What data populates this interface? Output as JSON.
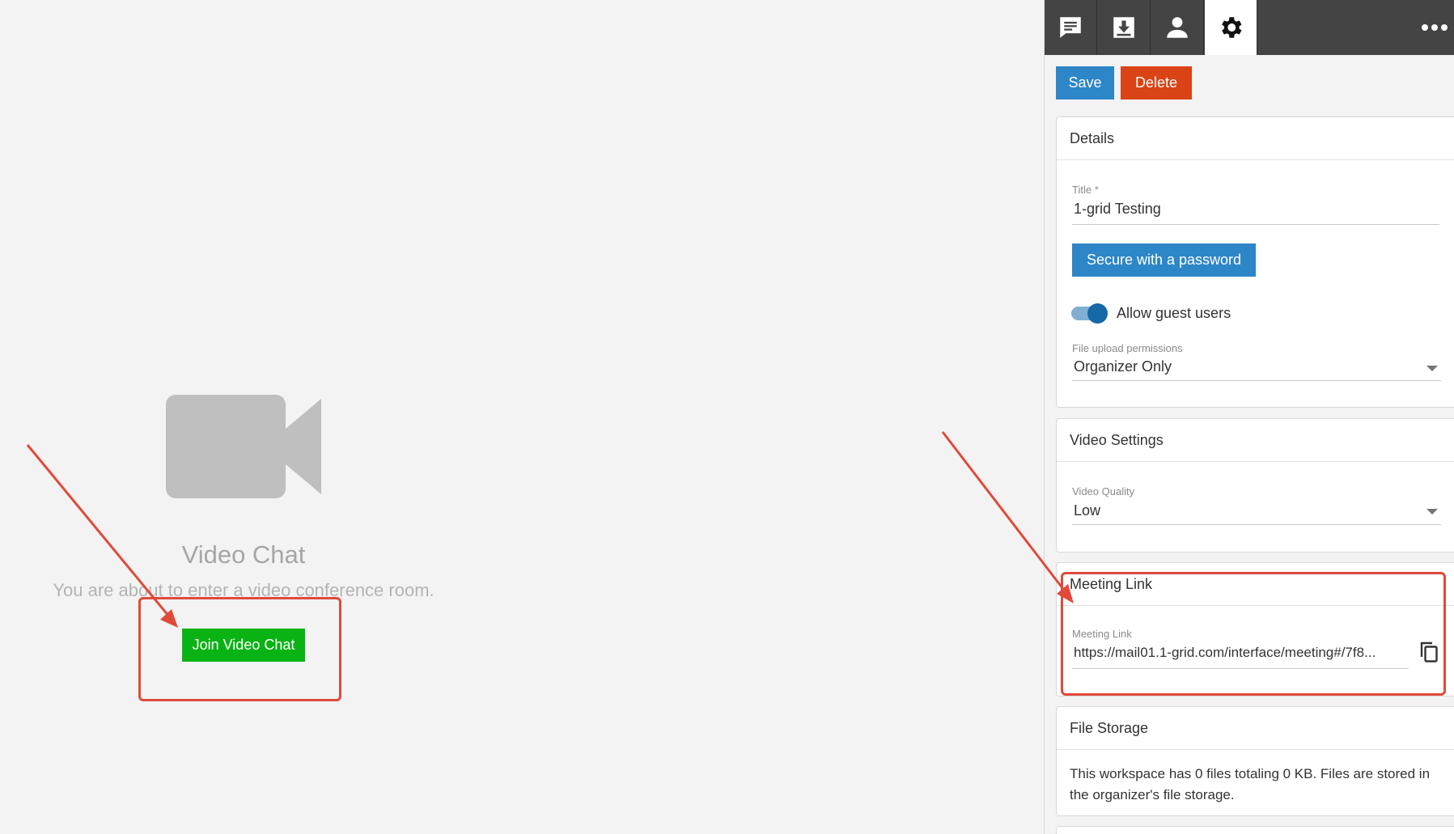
{
  "left": {
    "icon": "video-camera-icon",
    "title": "Video Chat",
    "subtitle": "You are about to enter a video conference room.",
    "join_label": "Join Video Chat"
  },
  "tabs": [
    {
      "icon": "chat-icon",
      "active": false
    },
    {
      "icon": "download-icon",
      "active": false
    },
    {
      "icon": "person-icon",
      "active": false
    },
    {
      "icon": "gear-icon",
      "active": true
    }
  ],
  "more_icon": "more-horizontal-icon",
  "actions": {
    "save_label": "Save",
    "delete_label": "Delete"
  },
  "details": {
    "header": "Details",
    "title_label": "Title *",
    "title_value": "1-grid Testing",
    "password_button": "Secure with a password",
    "guest_toggle_label": "Allow guest users",
    "guest_toggle_on": true,
    "upload_label": "File upload permissions",
    "upload_value": "Organizer Only"
  },
  "video_settings": {
    "header": "Video Settings",
    "quality_label": "Video Quality",
    "quality_value": "Low"
  },
  "meeting_link": {
    "header": "Meeting Link",
    "field_label": "Meeting Link",
    "field_value": "https://mail01.1-grid.com/interface/meeting#/7f8...",
    "copy_icon": "copy-icon"
  },
  "file_storage": {
    "header": "File Storage",
    "text": "This workspace has 0 files totaling 0 KB. Files are stored in the organizer's file storage."
  },
  "colors": {
    "primary": "#2d86c8",
    "danger": "#d94315",
    "success": "#0ab314",
    "tabbar": "#444444",
    "annotation": "#e04a3a"
  }
}
